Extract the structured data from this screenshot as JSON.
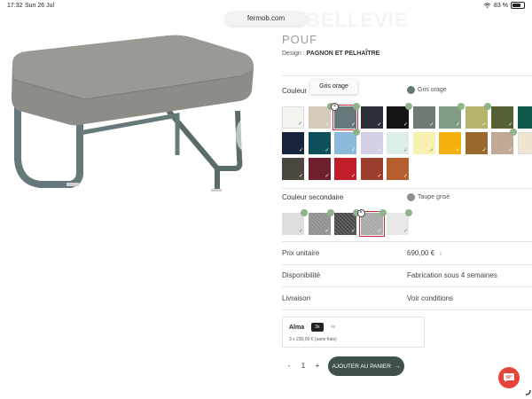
{
  "status_bar": {
    "time": "17:32",
    "date": "Sun 26 Jul",
    "battery": "83 %"
  },
  "browser": {
    "url": "fermob.com"
  },
  "product": {
    "collection_title_ghost": "BELLEVIE",
    "title": "POUF",
    "design_label": "Design :",
    "designer": "PAGNON ET PELHAÎTRE"
  },
  "primary_color": {
    "label": "Couleur",
    "selected_name": "Gris orage",
    "selected_hex": "#66797a",
    "tooltip": "Gris orage",
    "swatches": [
      "#f5f3ee",
      "#d4cbbb",
      "#66797a",
      "#2c3036",
      "#121514",
      "#6e7a72",
      "#829c86",
      "#b4b46d",
      "#556034",
      "#0f5a4a",
      "#18233d",
      "#0e4f5c",
      "#8db9da",
      "#d5d0e6",
      "#dceee6",
      "#f7f2b1",
      "#f4b10e",
      "#9a6a2c",
      "#c2a996",
      "#efe6d0",
      "#4d4741",
      "#70202c",
      "#c01e2b",
      "#9b3e2e",
      "#b55e2e"
    ]
  },
  "secondary_color": {
    "label": "Couleur secondaire",
    "selected_name": "Taupe grisé",
    "selected_hex": "#8e8e8b",
    "swatches": [
      "#dcdcdc",
      "#8f8f8f",
      "#4a4a4a",
      "#a8a8a8",
      "#e6e6e6"
    ]
  },
  "details": {
    "price_label": "Prix unitaire",
    "price_value": "690,00 €",
    "price_info": "i",
    "availability_label": "Disponibilité",
    "availability_value": "Fabrication sous 4 semaines",
    "delivery_label": "Livraison",
    "delivery_value": "Voir conditions"
  },
  "alma": {
    "name": "Alma",
    "option_3x": "3x",
    "option_4x": "4x",
    "detail": "3 x 230,00 € (sans frais)"
  },
  "cart": {
    "minus": "-",
    "quantity": "1",
    "plus": "+",
    "add_label": "AJOUTER AU PANIER",
    "arrow": "→"
  },
  "colors": {
    "accent": "#3f514a",
    "chat": "#e6443a",
    "selection": "#c0303a",
    "badge": "#8fb28a"
  }
}
